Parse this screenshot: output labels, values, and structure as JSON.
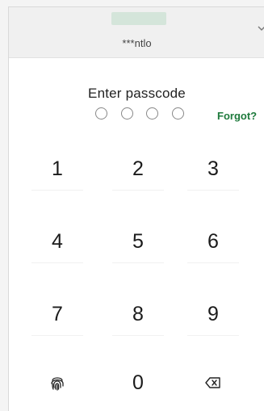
{
  "header": {
    "account_name": "***ntlo",
    "chevron_icon": "chevron-down-icon"
  },
  "passcode": {
    "title": "Enter passcode",
    "digits_entered": 0,
    "length": 4,
    "forgot_label": "Forgot?"
  },
  "keypad": {
    "keys": [
      "1",
      "2",
      "3",
      "4",
      "5",
      "6",
      "7",
      "8",
      "9",
      "0"
    ],
    "biometric_icon": "fingerprint-icon",
    "delete_icon": "backspace-icon"
  },
  "colors": {
    "accent": "#1e7a3c"
  }
}
